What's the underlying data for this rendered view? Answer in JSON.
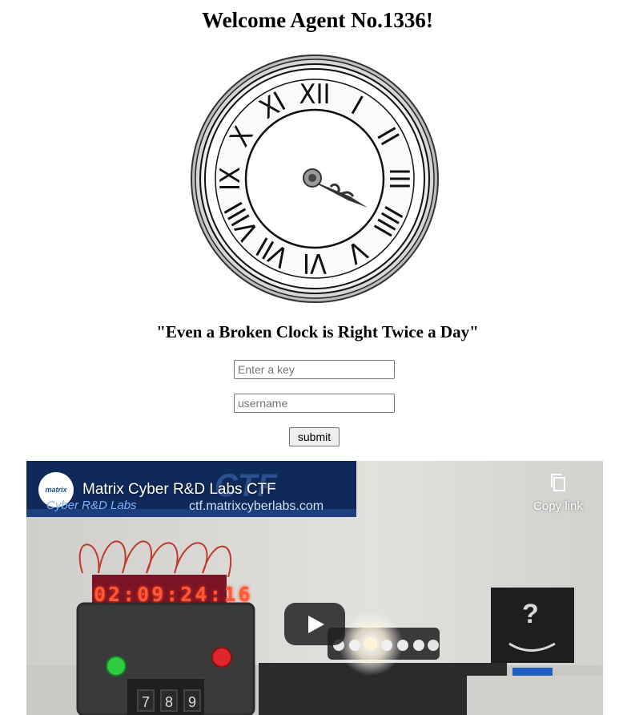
{
  "page": {
    "title": "Welcome Agent No.1336!",
    "quote": "\"Even a Broken Clock is Right Twice a Day\""
  },
  "clock": {
    "numerals": [
      "XII",
      "I",
      "II",
      "III",
      "IIII",
      "V",
      "VI",
      "VII",
      "VIII",
      "IX",
      "X",
      "XI"
    ]
  },
  "form": {
    "key_placeholder": "Enter a key",
    "username_placeholder": "username",
    "submit_label": "submit"
  },
  "video": {
    "title": "Matrix Cyber R&D Labs CTF",
    "channel_logo_text": "matrix",
    "banner_subtitle": "Cyber R&D Labs",
    "banner_url": "ctf.matrixcyberlabs.com",
    "copy_link_label": "Copy link",
    "timer_display": "02:09:24:16",
    "keypad_keys": [
      "7",
      "8",
      "9"
    ],
    "box_symbol": "?"
  },
  "icons": {
    "copy": "copy-icon",
    "play": "play-icon"
  }
}
